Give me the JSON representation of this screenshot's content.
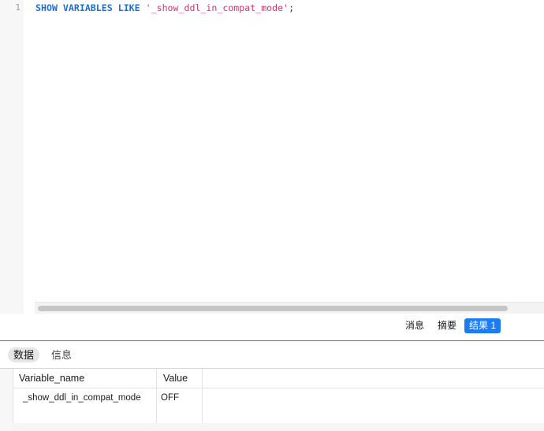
{
  "editor": {
    "line_number": "1",
    "code": {
      "keyword1": "SHOW",
      "keyword2": "VARIABLES",
      "keyword3": "LIKE",
      "string": "'_show_ddl_in_compat_mode'",
      "terminator": ";"
    }
  },
  "result_tabs": [
    {
      "label": "消息",
      "active": false
    },
    {
      "label": "摘要",
      "active": false
    },
    {
      "label": "结果 1",
      "active": true
    }
  ],
  "subtabs": [
    {
      "label": "数据",
      "active": true
    },
    {
      "label": "信息",
      "active": false
    }
  ],
  "table": {
    "columns": [
      "Variable_name",
      "Value"
    ],
    "rows": [
      [
        "_show_ddl_in_compat_mode",
        "OFF"
      ]
    ]
  },
  "colors": {
    "keyword": "#1f6fd1",
    "string": "#d6336c",
    "active_tab": "#1e7cf2"
  }
}
